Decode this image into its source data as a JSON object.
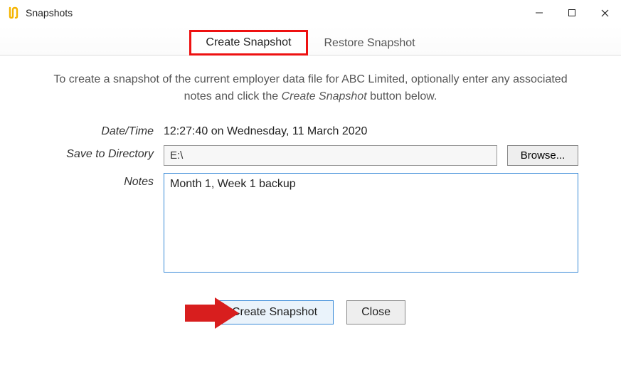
{
  "window": {
    "title": "Snapshots"
  },
  "tabs": {
    "create": "Create Snapshot",
    "restore": "Restore Snapshot"
  },
  "instruction": {
    "pre": "To create a snapshot of the current employer data file for ABC Limited, optionally enter any associated notes and click the ",
    "em": "Create Snapshot",
    "post": " button below."
  },
  "form": {
    "datetime_label": "Date/Time",
    "datetime_value": "12:27:40 on Wednesday, 11 March 2020",
    "directory_label": "Save to Directory",
    "directory_value": "E:\\",
    "browse_label": "Browse...",
    "notes_label": "Notes",
    "notes_value": "Month 1, Week 1 backup"
  },
  "footer": {
    "create_label": "Create Snapshot",
    "close_label": "Close"
  }
}
